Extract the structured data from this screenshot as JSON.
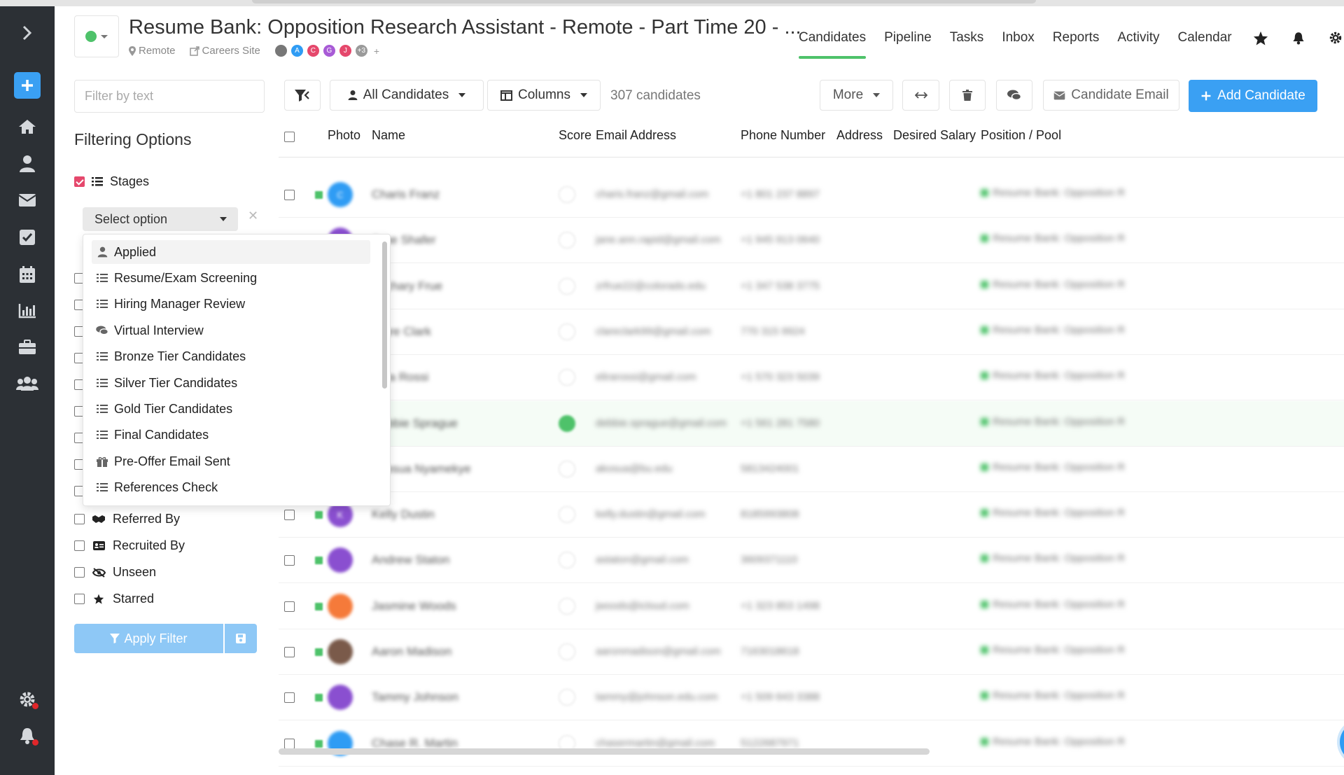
{
  "job": {
    "title": "Resume Bank: Opposition Research Assistant - Remote - Part Time 20 - ...",
    "location": "Remote",
    "careers_link": "Careers Site",
    "team_avatars": [
      {
        "letter": "",
        "color": "#777777"
      },
      {
        "letter": "A",
        "color": "#2f9cf4"
      },
      {
        "letter": "C",
        "color": "#e5486c"
      },
      {
        "letter": "G",
        "color": "#a85bd6"
      },
      {
        "letter": "J",
        "color": "#e5486c"
      },
      {
        "letter": "+3",
        "color": "#9a9a9a"
      }
    ],
    "add_member": "+"
  },
  "nav": {
    "tabs": [
      "Candidates",
      "Pipeline",
      "Tasks",
      "Inbox",
      "Reports",
      "Activity",
      "Calendar"
    ],
    "active": "Candidates"
  },
  "toolbar": {
    "filter_placeholder": "Filter by text",
    "view_select": "All Candidates",
    "columns_button": "Columns",
    "candidate_count": "307 candidates",
    "more_button": "More",
    "email_button": "Candidate Email",
    "add_button": "Add Candidate"
  },
  "filters": {
    "title": "Filtering Options",
    "stages_label": "Stages",
    "stages_checked": true,
    "select_placeholder": "Select option",
    "stage_options": [
      {
        "label": "Applied",
        "icon": "user-icon"
      },
      {
        "label": "Resume/Exam Screening",
        "icon": "list-icon"
      },
      {
        "label": "Hiring Manager Review",
        "icon": "list-icon"
      },
      {
        "label": "Virtual Interview",
        "icon": "comments-icon"
      },
      {
        "label": "Bronze Tier Candidates",
        "icon": "list-icon"
      },
      {
        "label": "Silver Tier Candidates",
        "icon": "list-icon"
      },
      {
        "label": "Gold Tier Candidates",
        "icon": "list-icon"
      },
      {
        "label": "Final Candidates",
        "icon": "list-icon"
      },
      {
        "label": "Pre-Offer Email Sent",
        "icon": "gift-icon"
      },
      {
        "label": "References Check",
        "icon": "list-icon"
      }
    ],
    "other_options": [
      {
        "label": "Referred By",
        "icon": "handshake-icon"
      },
      {
        "label": "Recruited By",
        "icon": "id-card-icon"
      },
      {
        "label": "Unseen",
        "icon": "eye-slash-icon"
      },
      {
        "label": "Starred",
        "icon": "star-icon"
      }
    ],
    "apply_button": "Apply Filter"
  },
  "table": {
    "columns": [
      "Photo",
      "Name",
      "Score",
      "Email Address",
      "Phone Number",
      "Address",
      "Desired Salary",
      "Position / Pool"
    ],
    "rows": [
      {
        "initial": "C",
        "color": "#2f9cf4",
        "name": "Charis Franz",
        "email": "charis.franz@gmail.com",
        "phone": "+1 801 237 8897",
        "position": "Resume Bank: Opposition Res...",
        "score_green": false
      },
      {
        "initial": "",
        "color": "#8a4fd0",
        "name": "Jane Shafer",
        "email": "jane.ann.rapid@gmail.com",
        "phone": "+1 945 913 0640",
        "position": "Resume Bank: Opposition Res...",
        "score_green": false
      },
      {
        "initial": "",
        "color": "#8a4fd0",
        "name": "Zachary Frue",
        "email": "zrfrue22@colorado.edu",
        "phone": "+1 347 538 3775",
        "position": "Resume Bank: Opposition Res...",
        "score_green": false
      },
      {
        "initial": "",
        "color": "#8a4fd0",
        "name": "Clare Clark",
        "email": "clareclark99@gmail.com",
        "phone": "770 315 9924",
        "position": "Resume Bank: Opposition Res...",
        "score_green": false
      },
      {
        "initial": "",
        "color": "#8a4fd0",
        "name": "Elira Rossi",
        "email": "elirarossi@gmail.com",
        "phone": "+1 570 323 5039",
        "position": "Resume Bank: Opposition Res...",
        "score_green": false
      },
      {
        "initial": "",
        "color": "#8a4fd0",
        "name": "Debbie Sprague",
        "email": "debbie.sprague@gmail.com",
        "phone": "+1 561 281 7580",
        "position": "Resume Bank: Opposition Res...",
        "score_green": true
      },
      {
        "initial": "",
        "color": "#8a4fd0",
        "name": "Akosua Nyamekye",
        "email": "akosua@bu.edu",
        "phone": "5813424001",
        "position": "Resume Bank: Opposition Res...",
        "score_green": false
      },
      {
        "initial": "K",
        "color": "#8a4fd0",
        "name": "Kelly Dustin",
        "email": "kelly.dustin@gmail.com",
        "phone": "8185993808",
        "position": "Resume Bank: Opposition Res...",
        "score_green": false
      },
      {
        "initial": "",
        "color": "#8a4fd0",
        "name": "Andrew Staton",
        "email": "astaton@gmail.com",
        "phone": "3609371110",
        "position": "Resume Bank: Opposition Res...",
        "score_green": false
      },
      {
        "initial": "",
        "color": "#f57a3a",
        "name": "Jasmine Woods",
        "email": "jwoods@icloud.com",
        "phone": "+1 323 853 1498",
        "position": "Resume Bank: Opposition Res...",
        "score_green": false
      },
      {
        "initial": "",
        "color": "#7a5a4a",
        "name": "Aaron Madison",
        "email": "aaronmadison@gmail.com",
        "phone": "7163018618",
        "position": "Resume Bank: Opposition Res...",
        "score_green": false
      },
      {
        "initial": "",
        "color": "#8a4fd0",
        "name": "Tammy Johnson",
        "email": "tammy@johnson.edu.com",
        "phone": "+1 509 643 3388",
        "position": "Resume Bank: Opposition Res...",
        "score_green": false
      },
      {
        "initial": "",
        "color": "#2f9cf4",
        "name": "Chase R. Martin",
        "email": "chasermartin@gmail.com",
        "phone": "5122687971",
        "position": "Resume Bank: Opposition Res...",
        "score_green": false
      }
    ]
  },
  "colors": {
    "accent": "#3aa0f3",
    "active_tab": "#4ec26a",
    "sidebar": "#2c3035",
    "checked": "#e5486c"
  }
}
